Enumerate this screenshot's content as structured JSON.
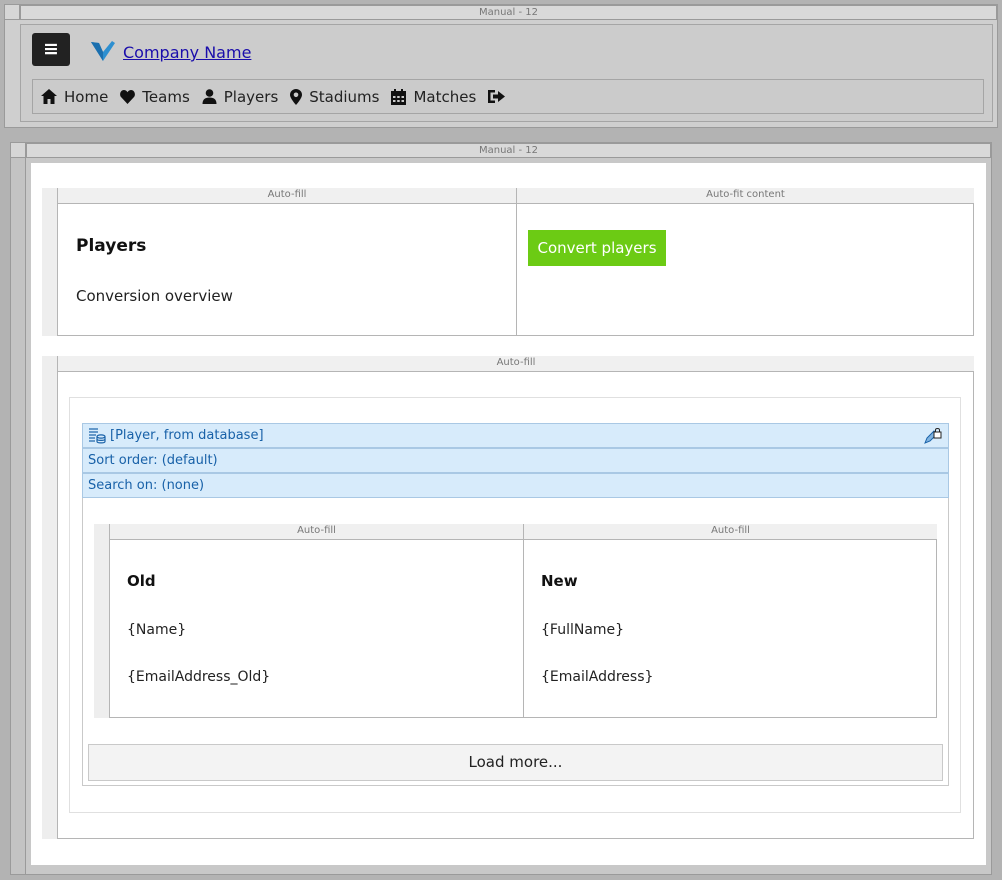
{
  "top_band": {
    "label": "Manual - 12"
  },
  "header": {
    "company_name": "Company Name",
    "menu_icon": "hamburger-icon",
    "logo_icon": "check-logo",
    "nav": [
      {
        "label": "Home",
        "icon": "home-icon"
      },
      {
        "label": "Teams",
        "icon": "heart-icon"
      },
      {
        "label": "Players",
        "icon": "user-icon"
      },
      {
        "label": "Stadiums",
        "icon": "map-marker-icon"
      },
      {
        "label": "Matches",
        "icon": "calendar-icon"
      },
      {
        "label": "",
        "icon": "sign-out-icon"
      }
    ]
  },
  "main_band": {
    "label": "Manual - 12"
  },
  "section1": {
    "col_a_label": "Auto-fill",
    "col_b_label": "Auto-fit content",
    "title": "Players",
    "subtitle": "Conversion overview",
    "convert_button": "Convert players"
  },
  "section2": {
    "label": "Auto-fill",
    "datasource": {
      "source": "[Player, from database]",
      "sort": "Sort order: (default)",
      "search": "Search on: (none)"
    },
    "repeater": {
      "col_a_label": "Auto-fill",
      "col_b_label": "Auto-fill",
      "old_heading": "Old",
      "new_heading": "New",
      "old_fields": [
        "{Name}",
        "{EmailAddress_Old}"
      ],
      "new_fields": [
        "{FullName}",
        "{EmailAddress}"
      ]
    },
    "load_more": "Load more..."
  },
  "colors": {
    "accent_green": "#6ccb14",
    "datasource_bg": "#d7ebfb",
    "datasource_text": "#1861a8",
    "link": "#1a0dab"
  }
}
